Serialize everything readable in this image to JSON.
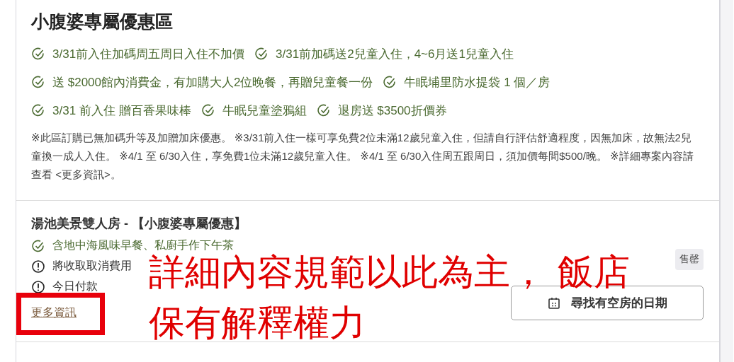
{
  "offer_section": {
    "title": "小腹婆專屬優惠區",
    "perk_rows": [
      [
        "3/31前入住加碼周五周日入住不加價",
        "3/31前加碼送2兒童入住，4~6月送1兒童入住"
      ],
      [
        "送 $2000館內消費金，有加購大人2位晚餐，再贈兒童餐一份",
        "牛眠埔里防水提袋 1 個／房"
      ],
      [
        "3/31 前入住 贈百香果味棒",
        "牛眠兒童塗鴉組",
        "退房送 $3500折價券"
      ]
    ],
    "note": "※此區訂購已無加碼升等及加贈加床優惠。 ※3/31前入住一樣可享免費2位未滿12歲兒童入住，但請自行評估舒適程度，因無加床，故無法2兒童換一成人入住。 ※4/1 至 6/30入住，享免費1位未滿12歲兒童入住。 ※4/1 至 6/30入住周五跟周日，須加價每間$500/晚。 ※詳細專案內容請查看 <更多資訊>。"
  },
  "room": {
    "title": "湯池美景雙人房 - 【小腹婆專屬優惠】",
    "features": [
      {
        "kind": "included",
        "text": "含地中海風味早餐、私廚手作下午茶"
      },
      {
        "kind": "notice",
        "text": "將收取取消費用"
      },
      {
        "kind": "notice",
        "text": "今日付款"
      }
    ],
    "more_link": "更多資訊",
    "badge": "售罄",
    "button": "尋找有空房的日期"
  },
  "annotation": {
    "lines": [
      "詳細內容規範以此為主， 飯店",
      "保有解釋權力"
    ]
  }
}
